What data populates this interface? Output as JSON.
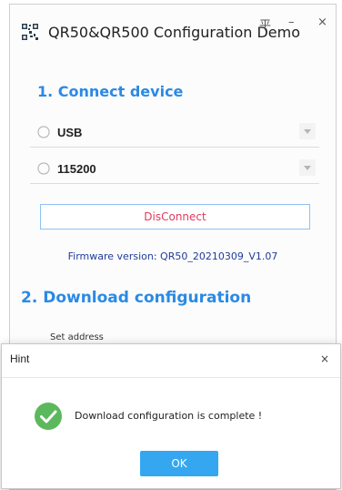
{
  "window": {
    "title": "QR50&QR500 Configuration Demo",
    "pin_glyph": "平",
    "min_glyph": "–",
    "close_glyph": "×"
  },
  "section1": {
    "title": "1. Connect device",
    "port_value": "USB",
    "baud_value": "115200",
    "disconnect_label": "DisConnect",
    "firmware_text": "Firmware version: QR50_20210309_V1.07"
  },
  "section2": {
    "title": "2. Download configuration",
    "set_address_label": "Set address"
  },
  "dialog": {
    "title": "Hint",
    "close_glyph": "×",
    "message": "Download configuration is complete !",
    "ok_label": "OK"
  },
  "icons": {
    "app": "qr-code-icon",
    "radio": "radio-unchecked-icon",
    "dropdown": "chevron-down-icon",
    "success": "check-circle-icon"
  },
  "colors": {
    "accent": "#2a8ae6",
    "disconnect_text": "#e03b5d",
    "firmware_text": "#1f3c99",
    "ok_button": "#34a7f0",
    "success_green": "#5cb85c"
  }
}
